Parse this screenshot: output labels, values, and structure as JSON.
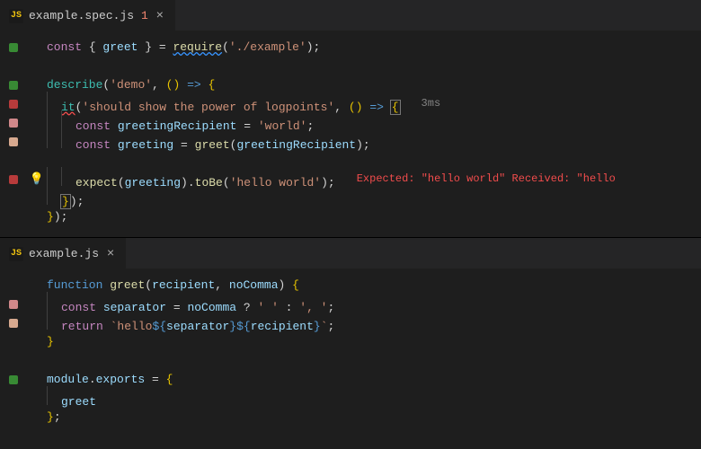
{
  "panes": [
    {
      "tab": {
        "icon": "JS",
        "title": "example.spec.js",
        "badge": "1",
        "closable": true
      },
      "lines": [
        {
          "gutter": "green",
          "indent": 0,
          "segments": [
            {
              "cls": "kw",
              "t": "const"
            },
            {
              "cls": "punc",
              "t": " { "
            },
            {
              "cls": "var",
              "t": "greet"
            },
            {
              "cls": "punc",
              "t": " } = "
            },
            {
              "cls": "fn squiggle-blue",
              "t": "require"
            },
            {
              "cls": "punc",
              "t": "("
            },
            {
              "cls": "str",
              "t": "'./example'"
            },
            {
              "cls": "punc",
              "t": ");"
            }
          ]
        },
        {
          "gutter": "",
          "indent": 0,
          "segments": []
        },
        {
          "gutter": "green",
          "indent": 0,
          "segments": [
            {
              "cls": "fn2",
              "t": "describe"
            },
            {
              "cls": "punc",
              "t": "("
            },
            {
              "cls": "str",
              "t": "'demo'"
            },
            {
              "cls": "punc",
              "t": ", "
            },
            {
              "cls": "brace",
              "t": "()"
            },
            {
              "cls": "punc",
              "t": " "
            },
            {
              "cls": "arrow",
              "t": "=>"
            },
            {
              "cls": "punc",
              "t": " "
            },
            {
              "cls": "brace",
              "t": "{"
            }
          ]
        },
        {
          "gutter": "red",
          "indent": 1,
          "segments": [
            {
              "cls": "fn2 squiggle-red",
              "t": "it"
            },
            {
              "cls": "punc",
              "t": "("
            },
            {
              "cls": "str",
              "t": "'should show the power of logpoints'"
            },
            {
              "cls": "punc",
              "t": ", "
            },
            {
              "cls": "brace",
              "t": "()"
            },
            {
              "cls": "punc",
              "t": " "
            },
            {
              "cls": "arrow",
              "t": "=>"
            },
            {
              "cls": "punc",
              "t": " "
            },
            {
              "cls": "brace hl-bracket",
              "t": "{"
            }
          ],
          "inlay": "3ms"
        },
        {
          "gutter": "pink",
          "indent": 2,
          "segments": [
            {
              "cls": "kw",
              "t": "const"
            },
            {
              "cls": "punc",
              "t": " "
            },
            {
              "cls": "var",
              "t": "greetingRecipient"
            },
            {
              "cls": "punc",
              "t": " = "
            },
            {
              "cls": "str",
              "t": "'world'"
            },
            {
              "cls": "punc",
              "t": ";"
            }
          ]
        },
        {
          "gutter": "peach",
          "indent": 2,
          "segments": [
            {
              "cls": "kw",
              "t": "const"
            },
            {
              "cls": "punc",
              "t": " "
            },
            {
              "cls": "var",
              "t": "greeting"
            },
            {
              "cls": "punc",
              "t": " = "
            },
            {
              "cls": "fn",
              "t": "greet"
            },
            {
              "cls": "punc",
              "t": "("
            },
            {
              "cls": "var",
              "t": "greetingRecipient"
            },
            {
              "cls": "punc",
              "t": ");"
            }
          ]
        },
        {
          "gutter": "",
          "indent": 0,
          "segments": []
        },
        {
          "gutter": "red",
          "glyph": "bulb",
          "indent": 2,
          "segments": [
            {
              "cls": "fn",
              "t": "expect"
            },
            {
              "cls": "punc",
              "t": "("
            },
            {
              "cls": "var",
              "t": "greeting"
            },
            {
              "cls": "punc",
              "t": ")."
            },
            {
              "cls": "fn",
              "t": "toBe"
            },
            {
              "cls": "punc",
              "t": "("
            },
            {
              "cls": "str",
              "t": "'hello world'"
            },
            {
              "cls": "punc",
              "t": ");"
            }
          ],
          "error": "Expected: \"hello world\" Received: \"hello"
        },
        {
          "gutter": "",
          "indent": 1,
          "segments": [
            {
              "cls": "brace hl-bracket",
              "t": "}"
            },
            {
              "cls": "punc",
              "t": ");"
            }
          ]
        },
        {
          "gutter": "",
          "indent": 0,
          "segments": [
            {
              "cls": "brace",
              "t": "}"
            },
            {
              "cls": "punc",
              "t": ");"
            }
          ]
        }
      ]
    },
    {
      "tab": {
        "icon": "JS",
        "title": "example.js",
        "badge": "",
        "closable": true
      },
      "lines": [
        {
          "gutter": "",
          "indent": 0,
          "segments": [
            {
              "cls": "kw2",
              "t": "function"
            },
            {
              "cls": "punc",
              "t": " "
            },
            {
              "cls": "fn",
              "t": "greet"
            },
            {
              "cls": "punc",
              "t": "("
            },
            {
              "cls": "var",
              "t": "recipient"
            },
            {
              "cls": "punc",
              "t": ", "
            },
            {
              "cls": "var",
              "t": "noComma"
            },
            {
              "cls": "punc",
              "t": ") "
            },
            {
              "cls": "brace",
              "t": "{"
            }
          ]
        },
        {
          "gutter": "pink",
          "indent": 1,
          "segments": [
            {
              "cls": "kw",
              "t": "const"
            },
            {
              "cls": "punc",
              "t": " "
            },
            {
              "cls": "var",
              "t": "separator"
            },
            {
              "cls": "punc",
              "t": " = "
            },
            {
              "cls": "var",
              "t": "noComma"
            },
            {
              "cls": "punc",
              "t": " ? "
            },
            {
              "cls": "str",
              "t": "' '"
            },
            {
              "cls": "punc",
              "t": " : "
            },
            {
              "cls": "str",
              "t": "', '"
            },
            {
              "cls": "punc",
              "t": ";"
            }
          ]
        },
        {
          "gutter": "peach",
          "indent": 1,
          "segments": [
            {
              "cls": "kw",
              "t": "return"
            },
            {
              "cls": "punc",
              "t": " "
            },
            {
              "cls": "str",
              "t": "`hello"
            },
            {
              "cls": "tmpl",
              "t": "${"
            },
            {
              "cls": "var",
              "t": "separator"
            },
            {
              "cls": "tmpl",
              "t": "}"
            },
            {
              "cls": "tmpl",
              "t": "${"
            },
            {
              "cls": "var",
              "t": "recipient"
            },
            {
              "cls": "tmpl",
              "t": "}"
            },
            {
              "cls": "str",
              "t": "`"
            },
            {
              "cls": "punc",
              "t": ";"
            }
          ]
        },
        {
          "gutter": "",
          "indent": 0,
          "segments": [
            {
              "cls": "brace",
              "t": "}"
            }
          ]
        },
        {
          "gutter": "",
          "indent": 0,
          "segments": []
        },
        {
          "gutter": "green",
          "indent": 0,
          "segments": [
            {
              "cls": "var",
              "t": "module"
            },
            {
              "cls": "punc",
              "t": "."
            },
            {
              "cls": "var",
              "t": "exports"
            },
            {
              "cls": "punc",
              "t": " = "
            },
            {
              "cls": "brace",
              "t": "{"
            }
          ]
        },
        {
          "gutter": "",
          "indent": 1,
          "segments": [
            {
              "cls": "var",
              "t": "greet"
            }
          ]
        },
        {
          "gutter": "",
          "indent": 0,
          "segments": [
            {
              "cls": "brace",
              "t": "}"
            },
            {
              "cls": "punc",
              "t": ";"
            }
          ]
        }
      ]
    }
  ]
}
